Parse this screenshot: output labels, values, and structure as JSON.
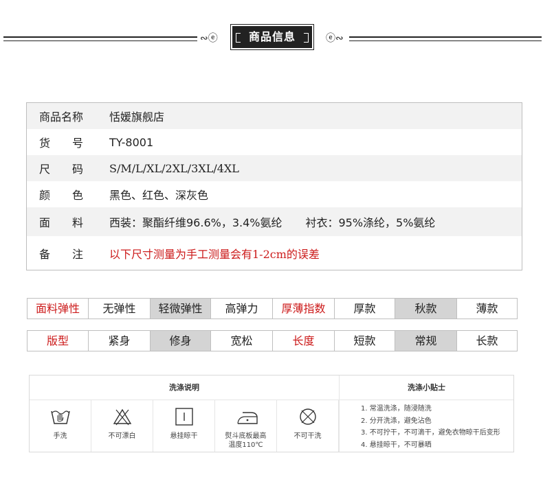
{
  "header": {
    "title": "商品信息",
    "left_ornament": "∾ⓔ",
    "right_ornament": "ⓔ∾"
  },
  "info": [
    {
      "label": "商品名称",
      "value": "恬媛旗舰店"
    },
    {
      "label": "货　　号",
      "value": "TY-8001"
    },
    {
      "label": "尺　　码",
      "value": "S/M/L/XL/2XL/3XL/4XL"
    },
    {
      "label": "颜　　色",
      "value": "黑色、红色、深灰色"
    },
    {
      "label": "面　　料",
      "value": "西装：聚酯纤维96.6%，3.4%氨纶",
      "value2": "衬衣：95%涤纶，5%氨纶"
    },
    {
      "label": "备　　注",
      "value": "以下尺寸测量为手工测量会有1-2cm的误差"
    }
  ],
  "attrs_row1": [
    "面料弹性",
    "无弹性",
    "轻微弹性",
    "高弹力",
    "厚薄指数",
    "厚款",
    "秋款",
    "薄款"
  ],
  "attrs_row2": [
    "版型",
    "紧身",
    "修身",
    "宽松",
    "长度",
    "短款",
    "常规",
    "长款"
  ],
  "wash": {
    "title": "洗涤说明",
    "tips_title": "洗涤小贴士",
    "items": [
      {
        "icon": "hand-wash-icon",
        "caption": "手洗"
      },
      {
        "icon": "no-bleach-icon",
        "caption": "不可漂白"
      },
      {
        "icon": "hang-dry-icon",
        "caption": "悬挂晾干"
      },
      {
        "icon": "iron-icon",
        "caption": "熨斗底板最高",
        "caption2": "温度110℃"
      },
      {
        "icon": "no-dry-clean-icon",
        "caption": "不可干洗"
      }
    ],
    "tips": [
      "1. 常温洗涤，随浸随洗",
      "2. 分开洗涤，避免沾色",
      "3. 不可拧干，不可滴干，避免衣物晾干后变形",
      "4. 悬挂晾干，不可暴晒"
    ]
  },
  "colors": {
    "accent_red": "#cc1a1a",
    "selected_gray": "#d4d4d4",
    "header_bg": "#222222"
  }
}
